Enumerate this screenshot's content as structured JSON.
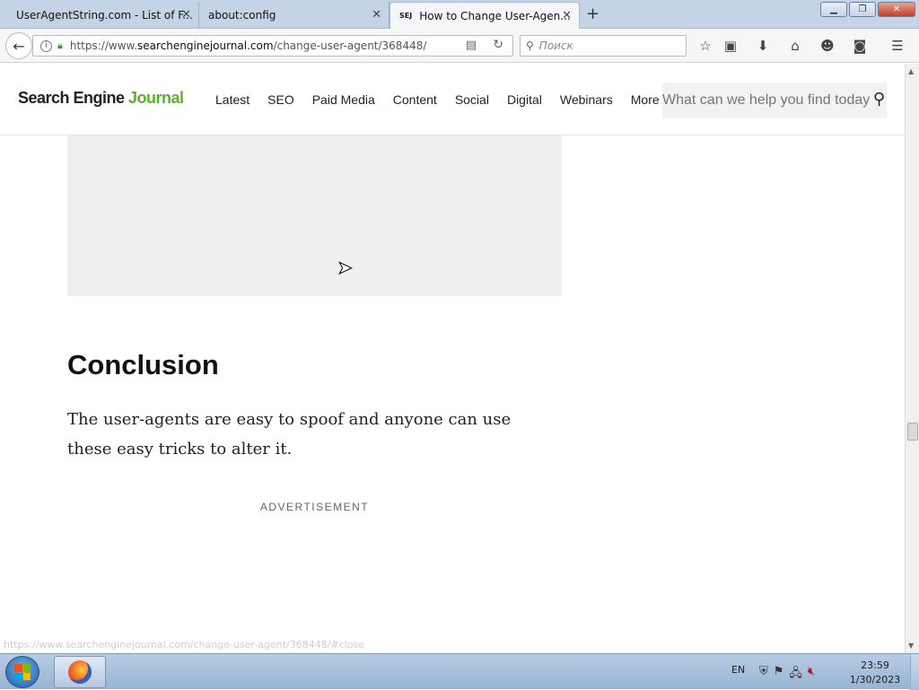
{
  "browser": {
    "tabs": [
      {
        "label": "UserAgentString.com - List of F...",
        "favicon": ""
      },
      {
        "label": "about:config",
        "favicon": ""
      },
      {
        "label": "How to Change User-Agen...",
        "favicon": "SEJ",
        "active": true
      }
    ],
    "url_prefix": "https://www.",
    "url_domain": "searchenginejournal.com",
    "url_path": "/change-user-agent/368448/",
    "search_placeholder": "Поиск",
    "status_url": "https://www.searchenginejournal.com/change-user-agent/368448/#close"
  },
  "site": {
    "logo_part1": "Search Engine ",
    "logo_part2": "Journal",
    "nav": [
      "Latest",
      "SEO",
      "Paid Media",
      "Content",
      "Social",
      "Digital",
      "Webinars",
      "More"
    ],
    "search_placeholder": "What can we help you find today?"
  },
  "article": {
    "heading": "Conclusion",
    "body": "The user-agents are easy to spoof and anyone can use these easy tricks to alter it.",
    "ad_label": "ADVERTISEMENT"
  },
  "taskbar": {
    "language": "EN",
    "time": "23:59",
    "date": "1/30/2023"
  },
  "colors": {
    "brand_green": "#5bb030",
    "titlebar": "#c4d4e6"
  }
}
